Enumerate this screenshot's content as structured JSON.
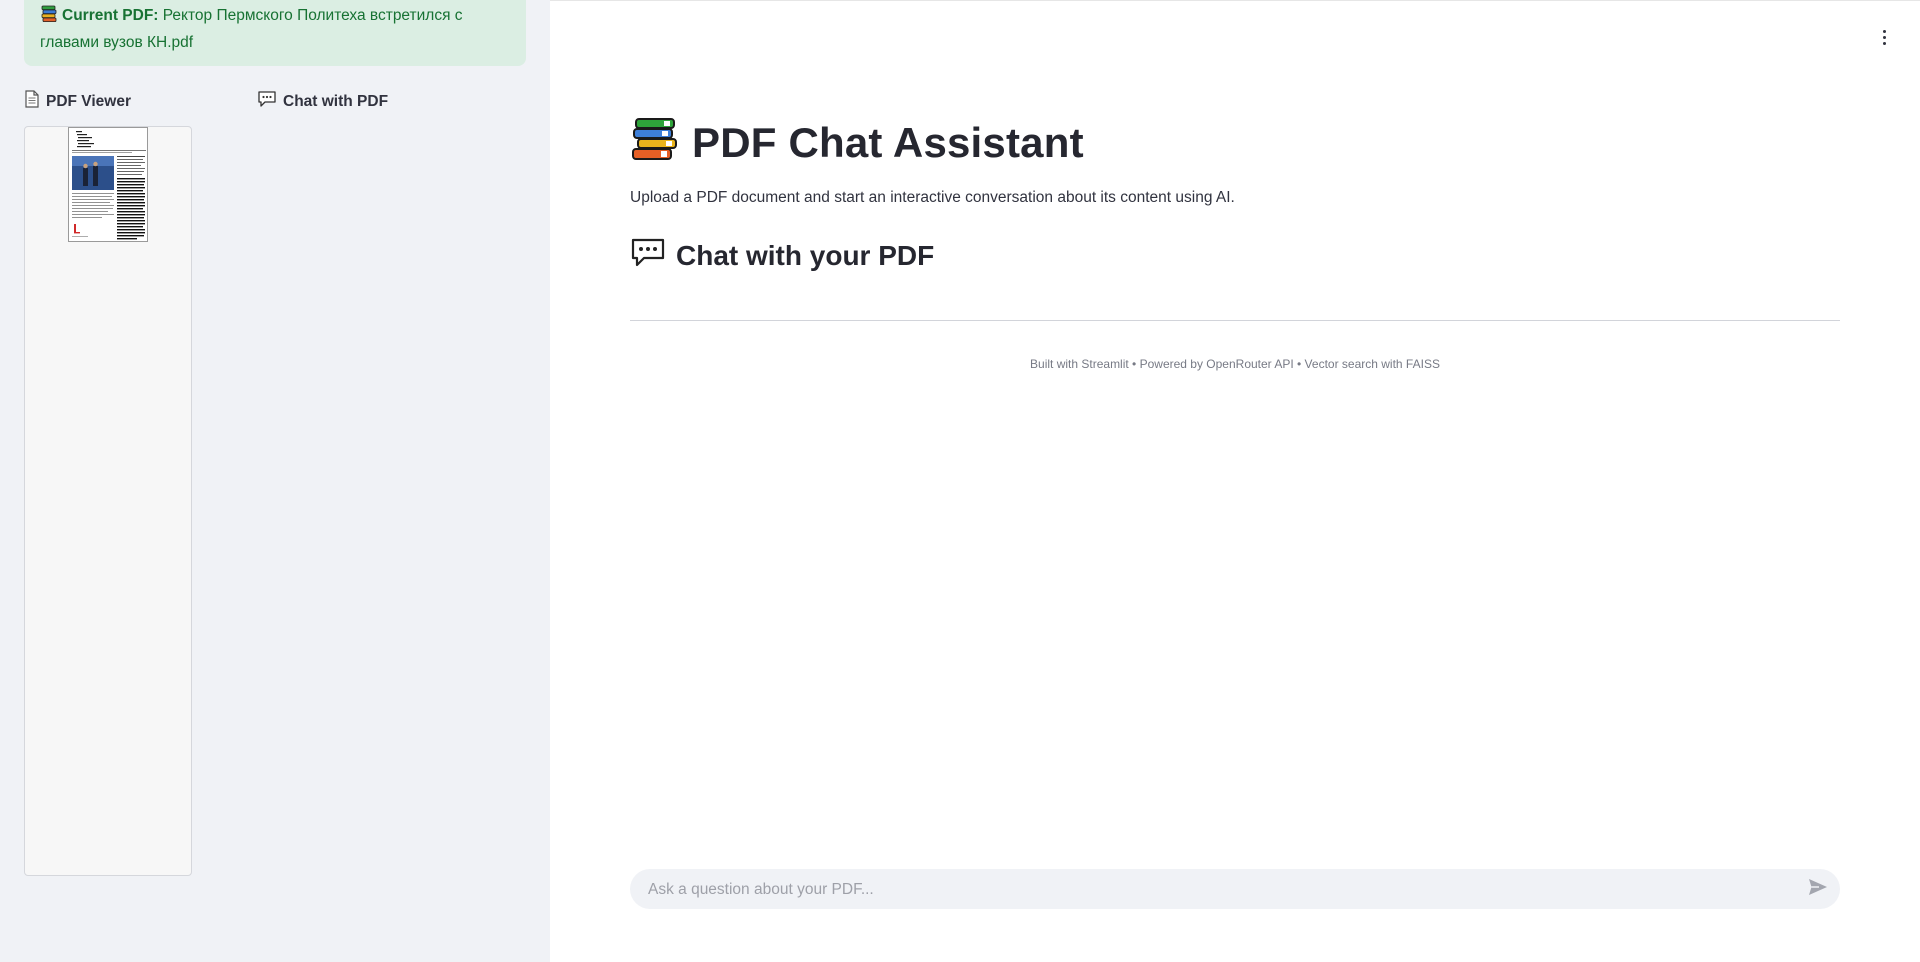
{
  "sidebar": {
    "alert": {
      "icon": "books-icon",
      "label": "Current PDF:",
      "filename": "Ректор Пермского Политеха встретился с главами вузов КН.pdf"
    },
    "tabs": [
      {
        "label": "PDF Viewer",
        "icon": "page-icon"
      },
      {
        "label": "Chat with PDF",
        "icon": "speech-balloon-icon"
      }
    ]
  },
  "main": {
    "title": "PDF Chat Assistant",
    "title_icon": "books-icon",
    "subtitle": "Upload a PDF document and start an interactive conversation about its content using AI.",
    "section_title": "Chat with your PDF",
    "section_icon": "speech-balloon-icon",
    "footer": "Built with Streamlit • Powered by OpenRouter API • Vector search with FAISS",
    "chat_input": {
      "placeholder": "Ask a question about your PDF...",
      "value": ""
    }
  },
  "colors": {
    "sidebar_bg": "#f0f2f6",
    "alert_bg": "#dbeee3",
    "alert_text": "#177233",
    "text": "#31333f"
  }
}
